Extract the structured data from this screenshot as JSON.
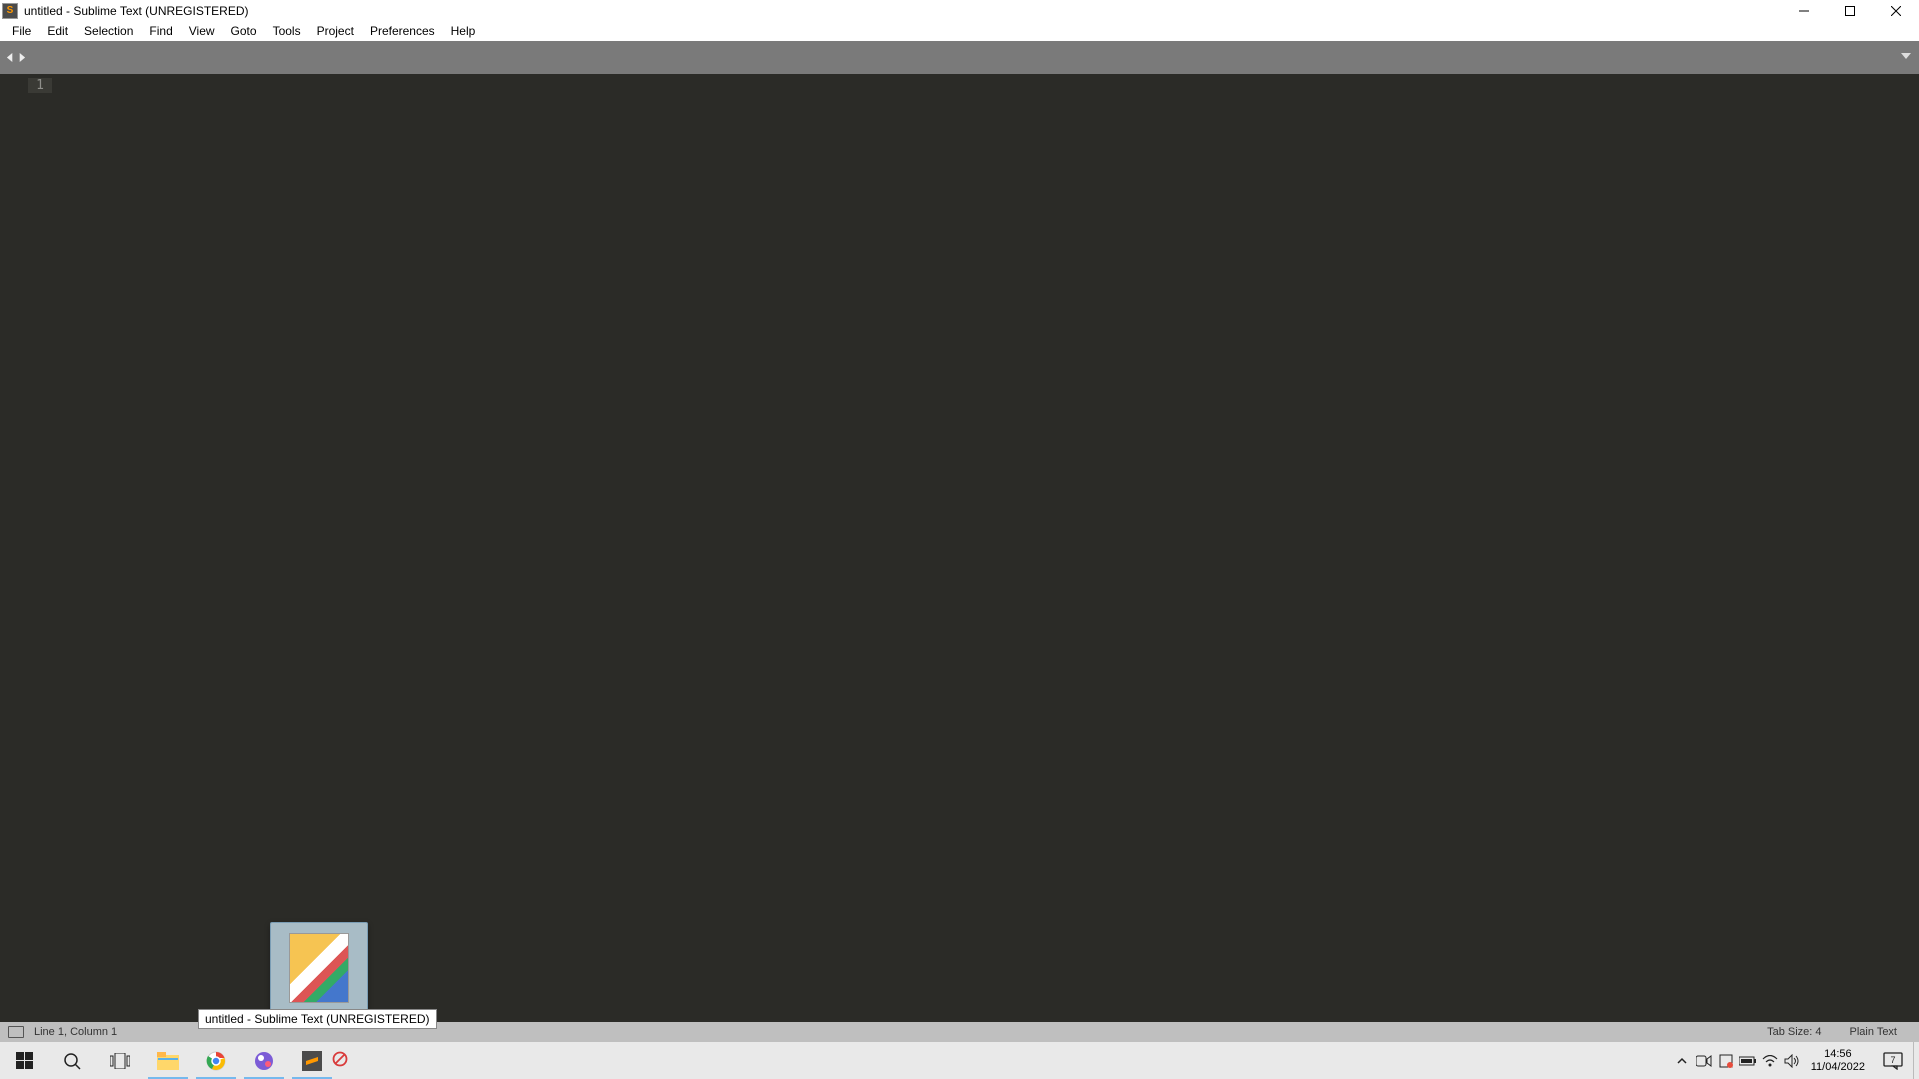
{
  "titlebar": {
    "app_icon_letter": "S",
    "title": "untitled - Sublime Text (UNREGISTERED)"
  },
  "menubar": {
    "items": [
      "File",
      "Edit",
      "Selection",
      "Find",
      "View",
      "Goto",
      "Tools",
      "Project",
      "Preferences",
      "Help"
    ]
  },
  "editor": {
    "line_number": "1"
  },
  "thumbnail": {
    "tooltip": "untitled - Sublime Text (UNREGISTERED)"
  },
  "statusbar": {
    "position": "Line 1, Column 1",
    "tab_size": "Tab Size: 4",
    "syntax": "Plain Text"
  },
  "taskbar": {
    "time": "14:56",
    "date": "11/04/2022",
    "notif_count": "7"
  }
}
